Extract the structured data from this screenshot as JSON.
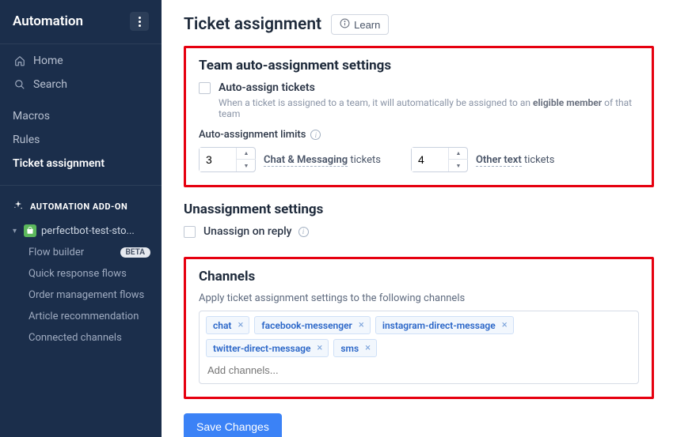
{
  "sidebar": {
    "title": "Automation",
    "nav": {
      "home": "Home",
      "search": "Search"
    },
    "sections": [
      "Macros",
      "Rules",
      "Ticket assignment"
    ],
    "addon_label": "AUTOMATION ADD-ON",
    "store_name": "perfectbot-test-sto...",
    "subnav": {
      "flow_builder": "Flow builder",
      "flow_builder_badge": "BETA",
      "quick_response": "Quick response flows",
      "order_mgmt": "Order management flows",
      "article_rec": "Article recommendation",
      "connected": "Connected channels"
    }
  },
  "page": {
    "title": "Ticket assignment",
    "learn_label": "Learn"
  },
  "team_settings": {
    "title": "Team auto-assignment settings",
    "auto_assign_label": "Auto-assign tickets",
    "help_prefix": "When a ticket is assigned to a team, it will automatically be assigned to an ",
    "help_bold": "eligible member",
    "help_suffix": " of that team",
    "limits_label": "Auto-assignment limits",
    "limit1_value": "3",
    "limit1_label_dashed": "Chat & Messaging",
    "limit1_label_rest": " tickets",
    "limit2_value": "4",
    "limit2_label_dashed": "Other text",
    "limit2_label_rest": " tickets"
  },
  "unassignment": {
    "title": "Unassignment settings",
    "checkbox_label": "Unassign on reply"
  },
  "channels": {
    "title": "Channels",
    "description": "Apply ticket assignment settings to the following channels",
    "tags": [
      "chat",
      "facebook-messenger",
      "instagram-direct-message",
      "twitter-direct-message",
      "sms"
    ],
    "placeholder": "Add channels..."
  },
  "save_label": "Save Changes"
}
